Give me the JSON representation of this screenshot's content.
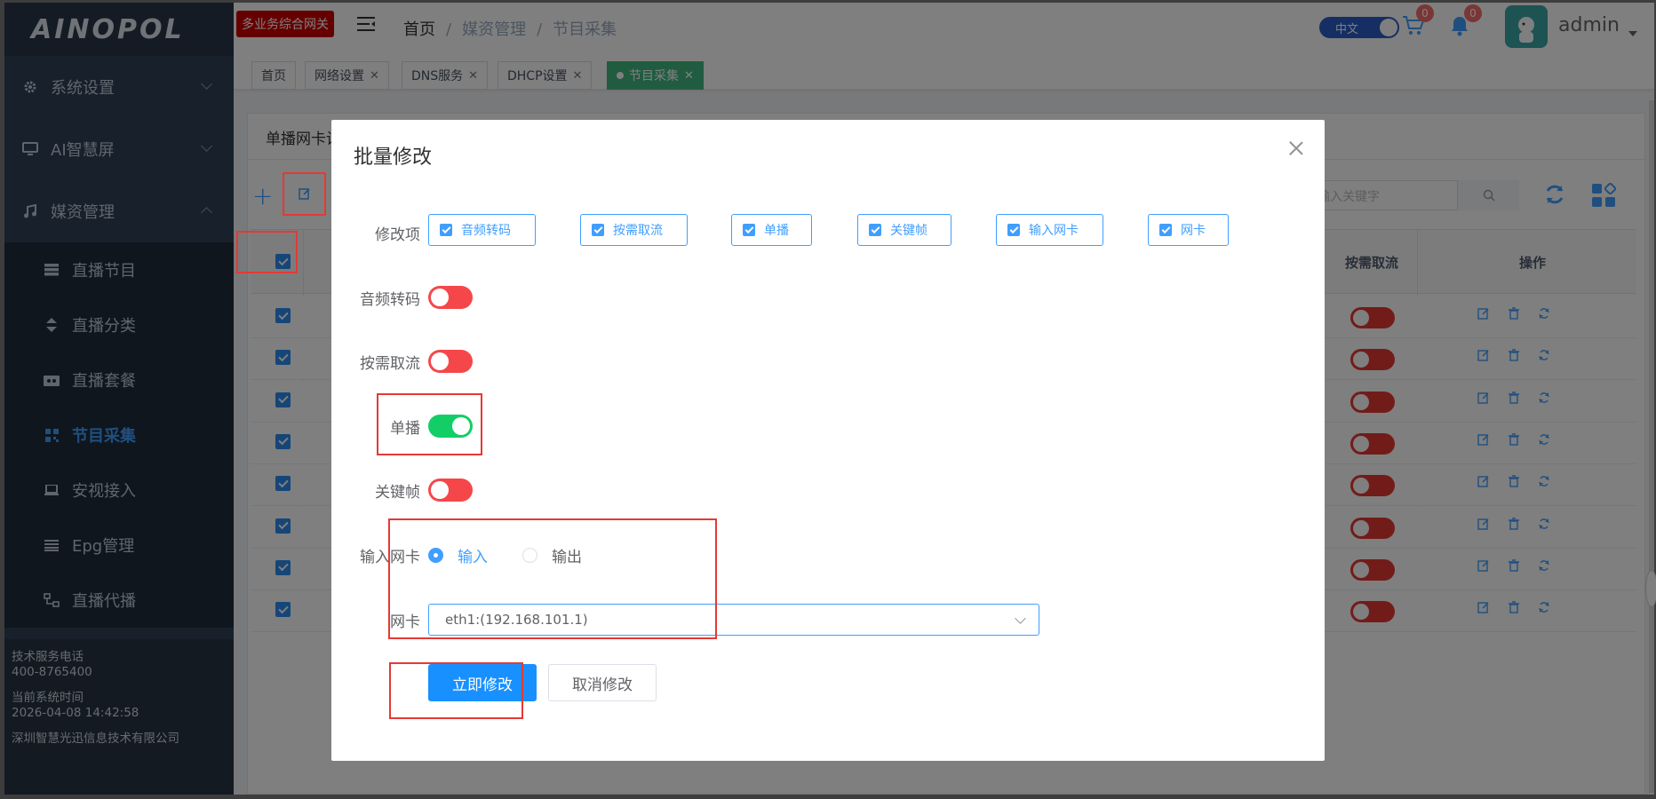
{
  "app": {
    "logo": "AINOPOL",
    "product_badge": "多业务综合网关"
  },
  "sidebar": {
    "groups": [
      {
        "label": "系统设置",
        "icon": "gear-icon"
      },
      {
        "label": "AI智慧屏",
        "icon": "monitor-icon"
      },
      {
        "label": "媒资管理",
        "icon": "music-note-icon"
      }
    ],
    "items": [
      {
        "label": "直播节目",
        "icon": "server-icon"
      },
      {
        "label": "直播分类",
        "icon": "sort-icon"
      },
      {
        "label": "直播套餐",
        "icon": "package-icon"
      },
      {
        "label": "节目采集",
        "icon": "qrcode-icon"
      },
      {
        "label": "安视接入",
        "icon": "laptop-icon"
      },
      {
        "label": "Epg管理",
        "icon": "list-icon"
      },
      {
        "label": "直播代播",
        "icon": "network-icon"
      }
    ],
    "info": {
      "support_label": "技术服务电话",
      "support_phone": "400-8765400",
      "time_label": "当前系统时间",
      "time_value": "2026-04-08 14:42:58",
      "company": "深圳智慧光迅信息技术有限公司"
    }
  },
  "header": {
    "breadcrumb": [
      "首页",
      "媒资管理",
      "节目采集"
    ],
    "lang_label": "中文",
    "cart_count": "0",
    "bell_count": "0",
    "user": "admin"
  },
  "tags": [
    {
      "label": "首页",
      "closable": false
    },
    {
      "label": "网络设置",
      "closable": true
    },
    {
      "label": "DNS服务",
      "closable": true
    },
    {
      "label": "DHCP设置",
      "closable": true
    },
    {
      "label": "节目采集",
      "closable": true,
      "active": true
    }
  ],
  "table": {
    "card_title": "单播网卡设",
    "search_placeholder": "输入关键字",
    "columns": {
      "on_demand": "按需取流",
      "actions": "操作"
    },
    "row_count": 8
  },
  "dialog": {
    "title": "批量修改",
    "fields_label": "修改项",
    "options": [
      "音频转码",
      "按需取流",
      "单播",
      "关键帧",
      "输入网卡",
      "网卡"
    ],
    "switches": [
      {
        "label": "音频转码",
        "on": false
      },
      {
        "label": "按需取流",
        "on": false
      },
      {
        "label": "单播",
        "on": true
      },
      {
        "label": "关键帧",
        "on": false
      }
    ],
    "nic_label": "输入网卡",
    "radio_in": "输入",
    "radio_out": "输出",
    "nic_select_label": "网卡",
    "nic_value": "eth1:(192.168.101.1)",
    "submit": "立即修改",
    "cancel": "取消修改"
  }
}
